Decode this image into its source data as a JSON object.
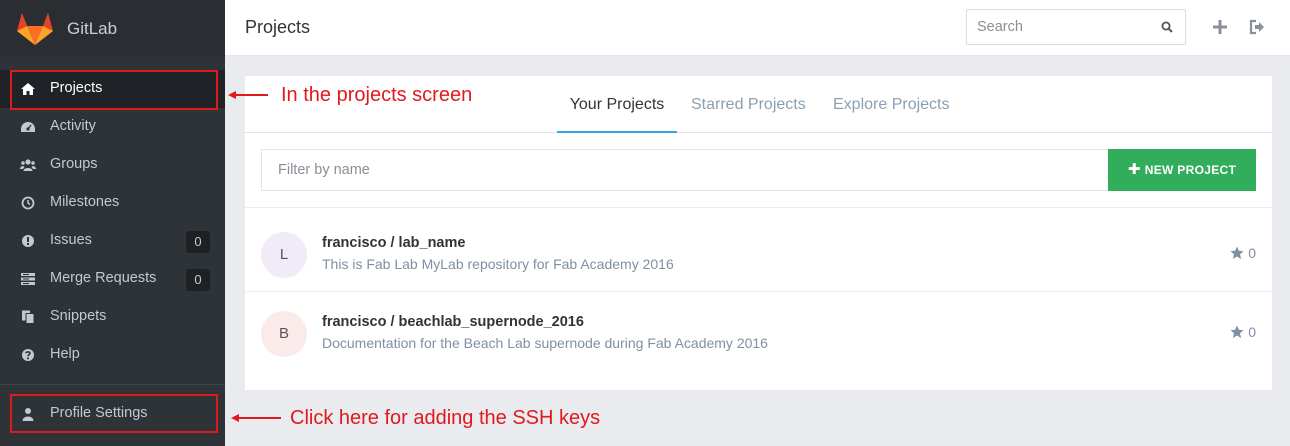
{
  "sidebar": {
    "brand": "GitLab",
    "items": [
      {
        "label": "Projects",
        "icon": "home-icon",
        "active": true
      },
      {
        "label": "Activity",
        "icon": "dashboard-icon"
      },
      {
        "label": "Groups",
        "icon": "users-icon"
      },
      {
        "label": "Milestones",
        "icon": "clock-icon"
      },
      {
        "label": "Issues",
        "icon": "exclamation-circle-icon",
        "count": "0"
      },
      {
        "label": "Merge Requests",
        "icon": "list-icon",
        "count": "0"
      },
      {
        "label": "Snippets",
        "icon": "copy-icon"
      },
      {
        "label": "Help",
        "icon": "question-circle-icon"
      }
    ],
    "profile": {
      "label": "Profile Settings",
      "icon": "user-icon"
    }
  },
  "header": {
    "title": "Projects",
    "search_placeholder": "Search"
  },
  "tabs": [
    "Your Projects",
    "Starred Projects",
    "Explore Projects"
  ],
  "filter": {
    "placeholder": "Filter by name",
    "new_project_label": "NEW PROJECT"
  },
  "projects": [
    {
      "avatar_letter": "L",
      "avatar_color": "#f1ebf7",
      "name": "francisco / lab_name",
      "description": "This is Fab Lab MyLab repository for Fab Academy 2016",
      "stars": "0"
    },
    {
      "avatar_letter": "B",
      "avatar_color": "#fbeaea",
      "name": "francisco / beachlab_supernode_2016",
      "description": "Documentation for the Beach Lab supernode during Fab Academy 2016",
      "stars": "0"
    }
  ],
  "annotations": {
    "projects_note": "In the projects screen",
    "profile_note": "Click here for adding the SSH keys"
  },
  "colors": {
    "annotation": "#e0191f",
    "new_project_button": "#31ad5b",
    "active_tab_underline": "#2eaadc"
  }
}
